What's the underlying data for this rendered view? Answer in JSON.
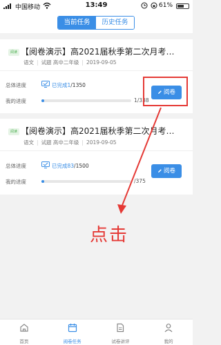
{
  "status_bar": {
    "carrier": "中国移动",
    "time": "13:49",
    "battery_percent": "61%",
    "battery_level": 0.61,
    "icons": [
      "signal-icon",
      "wifi-icon",
      "alarm-icon",
      "lock-icon",
      "battery-icon"
    ]
  },
  "tabs": {
    "current": "当前任务",
    "history": "历史任务"
  },
  "cards": [
    {
      "badge": "阅读",
      "title": "【阅卷演示】高2021届秋季第二次月考…",
      "subject": "语文",
      "exam_label": "试题",
      "grade": "高中二年级",
      "date": "2019-09-05",
      "overall_label": "总体进度",
      "done_prefix": "已完成",
      "done_count": "1",
      "done_total": "/1350",
      "my_label": "我的进度",
      "my_progress_text": "1/338",
      "my_progress_fraction": 0.03,
      "button": "阅卷"
    },
    {
      "badge": "阅读",
      "title": "【阅卷演示】高2021届秋季第二次月考…",
      "subject": "语文",
      "exam_label": "试题",
      "grade": "高中二年级",
      "date": "2019-09-05",
      "overall_label": "总体进度",
      "done_prefix": "已完成",
      "done_count": "83",
      "done_total": "/1500",
      "my_label": "我的进度",
      "my_progress_text": "/375",
      "my_progress_fraction": 0.03,
      "button": "阅卷"
    }
  ],
  "annotation": {
    "label": "点击",
    "color": "#e53935"
  },
  "tabbar": [
    {
      "label": "首页",
      "icon": "home-icon",
      "active": false
    },
    {
      "label": "阅卷任务",
      "icon": "calendar-icon",
      "active": true
    },
    {
      "label": "试卷讲评",
      "icon": "document-icon",
      "active": false
    },
    {
      "label": "我的",
      "icon": "user-icon",
      "active": false
    }
  ],
  "colors": {
    "accent": "#3a8ee6",
    "badge_green": "#4caf50",
    "annotation_red": "#e53935"
  }
}
